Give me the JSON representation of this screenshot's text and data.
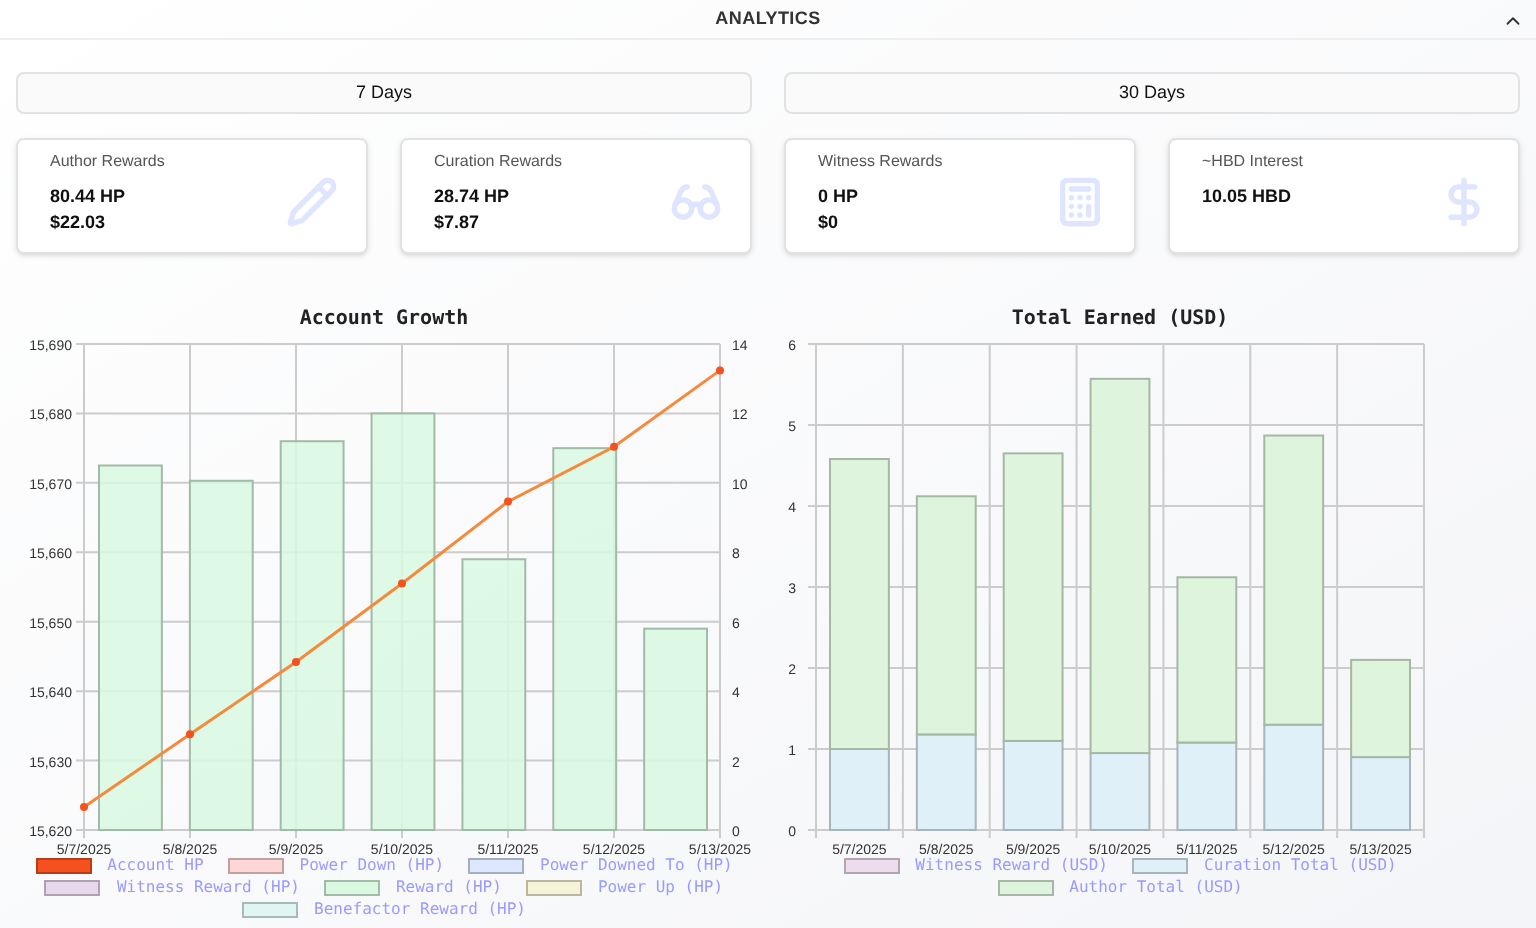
{
  "header": {
    "title": "ANALYTICS",
    "expanded": true
  },
  "periods": [
    {
      "label": "7 Days",
      "selected": false
    },
    {
      "label": "30 Days",
      "selected": false
    }
  ],
  "cards": [
    {
      "title": "Author Rewards",
      "lines": [
        "80.44 HP",
        "$22.03"
      ]
    },
    {
      "title": "Curation Rewards",
      "lines": [
        "28.74 HP",
        "$7.87"
      ]
    },
    {
      "title": "Witness Rewards",
      "lines": [
        "0 HP",
        "$0"
      ]
    },
    {
      "title": "~HBD Interest",
      "lines": [
        "10.05 HBD"
      ]
    }
  ],
  "account_growth": {
    "chart_data": {
      "type": "bar",
      "title": "Account Growth",
      "grid": true,
      "legend": "bottom",
      "categories": [
        "5/7/2025",
        "5/8/2025",
        "5/9/2025",
        "5/10/2025",
        "5/11/2025",
        "5/12/2025",
        "5/13/2025"
      ],
      "ylim": [
        15620,
        15690
      ],
      "yticks": [
        {
          "value": 15620,
          "label": "15,620"
        },
        {
          "value": 15630,
          "label": "15,630"
        },
        {
          "value": 15640,
          "label": "15,640"
        },
        {
          "value": 15650,
          "label": "15,650"
        },
        {
          "value": 15660,
          "label": "15,660"
        },
        {
          "value": 15670,
          "label": "15,670"
        },
        {
          "value": 15680,
          "label": "15,680"
        },
        {
          "value": 15690,
          "label": "15,690"
        }
      ],
      "series": [
        {
          "name": "Account HP",
          "type": "line",
          "marker": true,
          "color": "#f4511e",
          "values": [
            15623.3,
            15633.8,
            15644.2,
            15655.5,
            15667.3,
            15675.2,
            15686.2
          ]
        },
        {
          "name": "Power Down (HP)",
          "color": "#ffd6d6",
          "values": [
            null,
            null,
            null,
            null,
            null,
            null,
            null
          ]
        },
        {
          "name": "Power Downed To (HP)",
          "color": "#dce8ff",
          "values": [
            null,
            null,
            null,
            null,
            null,
            null,
            null
          ]
        },
        {
          "name": "Witness Reward (HP)",
          "color": "#e8d8ec",
          "values": [
            null,
            null,
            null,
            null,
            null,
            null,
            null
          ]
        },
        {
          "name": "Reward (HP)",
          "color": "#d8f8e0",
          "values": [
            15672.5,
            15670.3,
            15676,
            15680,
            15659,
            15675,
            15649
          ]
        },
        {
          "name": "Power Up (HP)",
          "color": "#f8f2d8",
          "values": [
            null,
            null,
            null,
            null,
            null,
            null,
            null
          ]
        },
        {
          "name": "Benefactor Reward (HP)",
          "color": "#e0f6f4",
          "values": [
            null,
            null,
            null,
            null,
            null,
            null,
            null
          ]
        }
      ]
    },
    "right_axis": [
      "14",
      "12",
      "10",
      "8",
      "6",
      "4",
      "2",
      "0"
    ]
  },
  "total_earned": {
    "chart_data": {
      "type": "bar",
      "stacked": true,
      "grid": true,
      "legend": "bottom",
      "title": "Total Earned (USD)",
      "categories": [
        "5/7/2025",
        "5/8/2025",
        "5/9/2025",
        "5/10/2025",
        "5/11/2025",
        "5/12/2025",
        "5/13/2025"
      ],
      "ylim": [
        0,
        6
      ],
      "yticks": [
        0,
        1,
        2,
        3,
        4,
        5,
        6
      ],
      "series": [
        {
          "name": "Witness Reward (USD)",
          "color": "#ecdcec",
          "values": [
            0,
            0,
            0,
            0,
            0,
            0,
            0
          ]
        },
        {
          "name": "Curation Total (USD)",
          "color": "#dff0f8",
          "values": [
            1.0,
            1.18,
            1.1,
            0.95,
            1.08,
            1.3,
            0.9
          ]
        },
        {
          "name": "Author Total (USD)",
          "color": "#dff4dc",
          "values": [
            3.58,
            2.94,
            3.55,
            4.62,
            2.04,
            3.57,
            1.2
          ]
        }
      ]
    }
  }
}
